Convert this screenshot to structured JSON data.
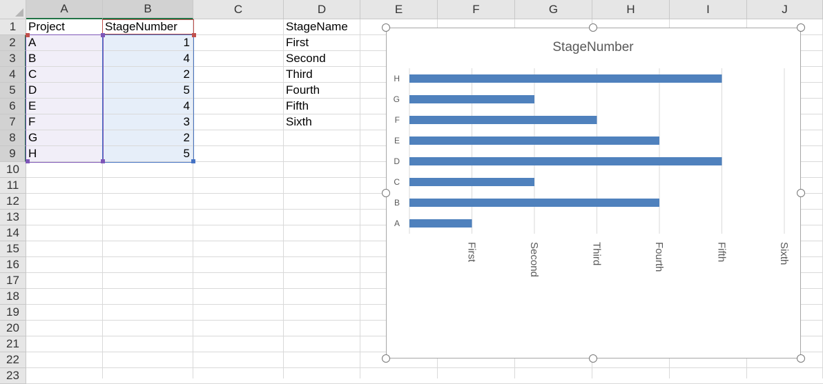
{
  "sheet": {
    "columns": [
      "A",
      "B",
      "C",
      "D",
      "E",
      "F",
      "G",
      "H",
      "I",
      "J"
    ],
    "rows": [
      "1",
      "2",
      "3",
      "4",
      "5",
      "6",
      "7",
      "8",
      "9",
      "10",
      "11",
      "12",
      "13",
      "14",
      "15",
      "16",
      "17",
      "18",
      "19",
      "20",
      "21",
      "22",
      "23"
    ],
    "cells": {
      "A": [
        "Project",
        "A",
        "B",
        "C",
        "D",
        "E",
        "F",
        "G",
        "H"
      ],
      "B": [
        "StageNumber",
        "1",
        "4",
        "2",
        "5",
        "4",
        "3",
        "2",
        "5"
      ],
      "D": [
        "StageName",
        "First",
        "Second",
        "Third",
        "Fourth",
        "Fifth",
        "Sixth"
      ]
    },
    "colors": {
      "project_range": "#f1eef8",
      "stage_range": "#e6eef9",
      "project_border": "#7e57b8",
      "stage_border": "#4472c4",
      "header_border": "#c0504d"
    }
  },
  "chart_data": {
    "type": "bar",
    "orientation": "horizontal",
    "title": "StageNumber",
    "categories": [
      "A",
      "B",
      "C",
      "D",
      "E",
      "F",
      "G",
      "H"
    ],
    "values": [
      1,
      4,
      2,
      5,
      4,
      3,
      2,
      5
    ],
    "x_tick_labels": [
      "First",
      "Second",
      "Third",
      "Fourth",
      "Fifth",
      "Sixth"
    ],
    "xlim": [
      0,
      6
    ],
    "grid": true,
    "legend": "none",
    "bar_color": "#4f81bd"
  }
}
